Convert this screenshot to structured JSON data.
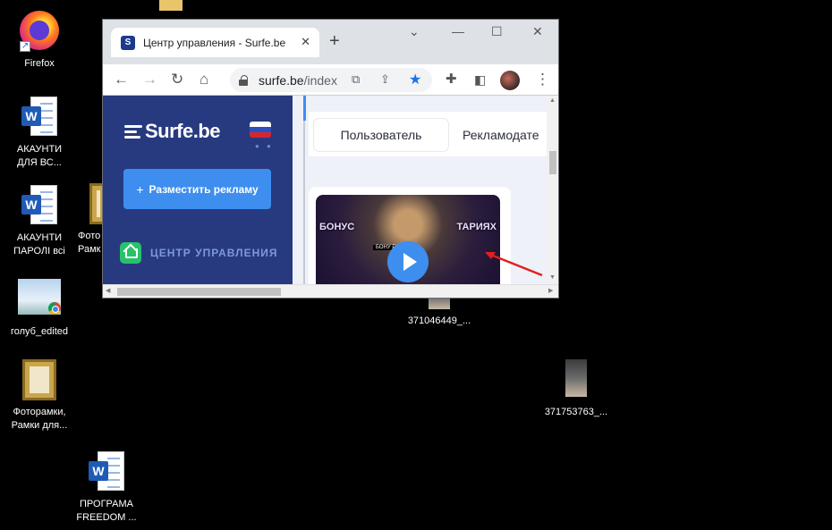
{
  "desktop": {
    "icons": [
      {
        "label_line1": "Firefox",
        "label_line2": ""
      },
      {
        "label_line1": "АКАУНТИ",
        "label_line2": "ДЛЯ ВС..."
      },
      {
        "label_line1": "АКАУНТИ",
        "label_line2": "ПАРОЛІ всі"
      },
      {
        "label_line1": "голуб_edited",
        "label_line2": ""
      },
      {
        "label_line1": "Фоторамки,",
        "label_line2": "Рамки для..."
      },
      {
        "label_line1": "ПРОГРАМА",
        "label_line2": "FREEDOM ..."
      },
      {
        "label_line1": "Фото",
        "label_line2": "Рамк"
      },
      {
        "label_line1": "371046449_...",
        "label_line2": ""
      },
      {
        "label_line1": "371753763_...",
        "label_line2": ""
      }
    ]
  },
  "browser": {
    "tab_title": "Центр управления - Surfe.be",
    "tab_favicon": "S",
    "url_host": "surfe.be",
    "url_path": "/index",
    "window_controls": {
      "minimize": "—",
      "maximize": "☐",
      "close": "✕",
      "tab_search": "⌄"
    }
  },
  "site": {
    "brand": "Surfe.be",
    "place_ad_button": "Разместить рекламу",
    "control_center": "ЦЕНТР УПРАВЛЕНИЯ",
    "tabs": [
      "Пользователь",
      "Рекламодате"
    ],
    "video_text_left": "БОНУС",
    "video_text_right": "ТАРИЯХ",
    "video_subtitle": "БОНУ             РИЯХ"
  },
  "colors": {
    "sidebar": "#273a80",
    "accent": "#3e8ef0",
    "green": "#27c26a",
    "arrow": "#e02020"
  }
}
